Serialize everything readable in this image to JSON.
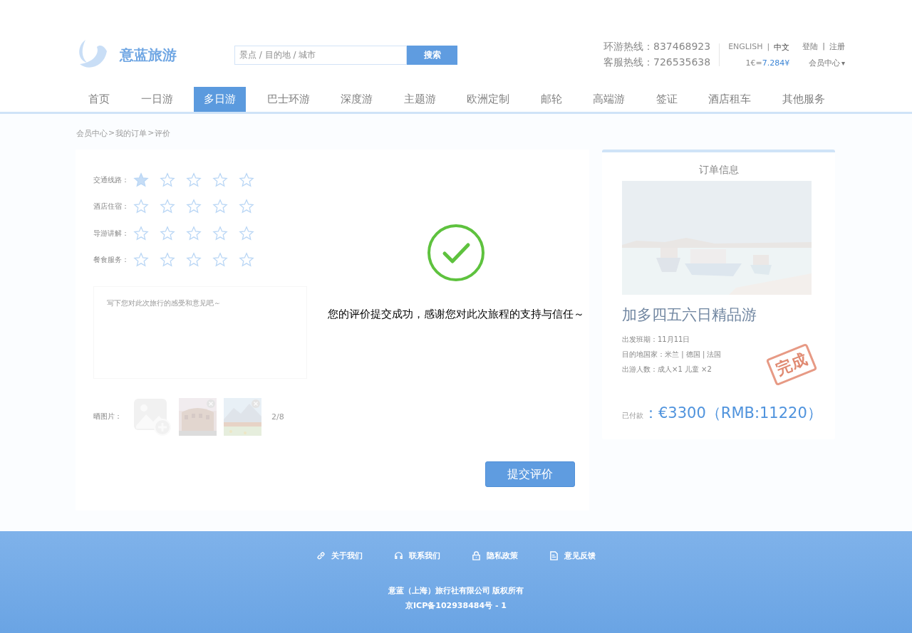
{
  "header": {
    "logo_text": "意蓝旅游",
    "search": {
      "placeholder": "景点 / 目的地 / 城市",
      "button": "搜索"
    },
    "hotlines": [
      "环游热线：837468923",
      "客服热线：726535638"
    ],
    "languages": [
      {
        "label": "ENGLISH",
        "selected": false
      },
      {
        "label": "中文",
        "selected": true
      }
    ],
    "languages_separator": "|",
    "exchange_rate": {
      "prefix": "1€=",
      "value": "7.284¥"
    },
    "account_links": [
      "登陆",
      "注册"
    ],
    "account_separator": "|",
    "member_menu": "会员中心",
    "member_caret": "▾"
  },
  "nav": [
    {
      "label": "首页",
      "selected": false
    },
    {
      "label": "一日游",
      "selected": false
    },
    {
      "label": "多日游",
      "selected": true
    },
    {
      "label": "巴士环游",
      "selected": false
    },
    {
      "label": "深度游",
      "selected": false
    },
    {
      "label": "主题游",
      "selected": false
    },
    {
      "label": "欧洲定制",
      "selected": false
    },
    {
      "label": "邮轮",
      "selected": false
    },
    {
      "label": "高端游",
      "selected": false
    },
    {
      "label": "签证",
      "selected": false
    },
    {
      "label": "酒店租车",
      "selected": false
    },
    {
      "label": "其他服务",
      "selected": false
    }
  ],
  "breadcrumb": [
    "会员中心",
    "我的订单",
    "评价"
  ],
  "breadcrumb_separator": ">",
  "review": {
    "ratings": [
      {
        "label": "交通线路：",
        "stars": 1
      },
      {
        "label": "酒店住宿：",
        "stars": 0
      },
      {
        "label": "导游讲解：",
        "stars": 0
      },
      {
        "label": "餐食服务：",
        "stars": 0
      }
    ],
    "comment": {
      "placeholder": "写下您对此次旅行的感受和意见吧～"
    },
    "photos": {
      "label": "晒图片：",
      "count": "2/8"
    },
    "submit": "提交评价"
  },
  "order": {
    "title": "订单信息",
    "tour_name": "加多四五六日精品游",
    "details": [
      "出发班期：11月11日",
      "目的地国家：米兰 | 德国 | 法国",
      "出游人数：成人×1  儿童 ×2"
    ],
    "stamp": "完成",
    "paid_label": "已付款",
    "paid_amount": "：€3300（RMB:11220）"
  },
  "footer": {
    "links": [
      {
        "kind": "link",
        "label": "关于我们"
      },
      {
        "kind": "headset",
        "label": "联系我们"
      },
      {
        "kind": "lock",
        "label": "隐私政策"
      },
      {
        "kind": "note",
        "label": "意见反馈"
      }
    ],
    "copyright": [
      "意蓝（上海）旅行社有限公司 版权所有",
      "京ICP备102938484号 - 1"
    ]
  },
  "dialog": {
    "message": "您的评价提交成功，感谢您对此次旅程的支持与信任～"
  }
}
